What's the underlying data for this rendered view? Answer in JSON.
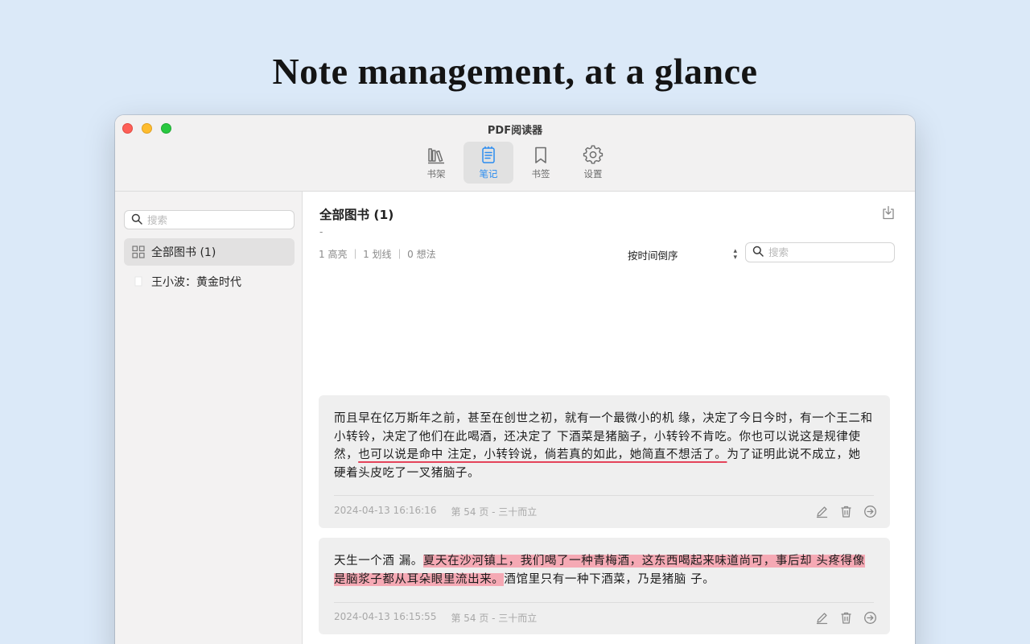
{
  "headline": "Note management, at a glance",
  "window": {
    "title": "PDF阅读器"
  },
  "toolbar": {
    "items": [
      {
        "label": "书架",
        "icon": "bookshelf-icon"
      },
      {
        "label": "笔记",
        "icon": "notes-icon",
        "active": true
      },
      {
        "label": "书签",
        "icon": "bookmark-icon"
      },
      {
        "label": "设置",
        "icon": "gear-icon"
      }
    ]
  },
  "sidebar": {
    "search_placeholder": "搜索",
    "items": [
      {
        "label": "全部图书 (1)",
        "icon": "grid-icon",
        "selected": true
      },
      {
        "label": "王小波：黄金时代",
        "icon": "book-icon"
      }
    ]
  },
  "main": {
    "title": "全部图书 (1)",
    "dash": "-",
    "stats": "1 高亮 ｜ 1 划线 ｜ 0 想法",
    "sort_label": "按时间倒序",
    "search_placeholder": "搜索"
  },
  "notes": [
    {
      "text_plain": "而且早在亿万斯年之前，甚至在创世之初，就有一个最微小的机 缘，决定了今日今时，有一个王二和小转铃，决定了他们在此喝酒，还决定了 下酒菜是猪脑子，小转铃不肯吃。你也可以说这是规律使然，",
      "text_marked": "也可以说是命中 注定，小转铃说，倘若真的如此，她简直不想活了。",
      "text_after": "为了证明此说不成立，她 硬着头皮吃了一叉猪脑子。",
      "timestamp": "2024-04-13 16:16:16",
      "location": "第 54 页 - 三十而立",
      "style": "underline"
    },
    {
      "text_plain": "天生一个酒 漏。",
      "text_marked": "夏天在沙河镇上，我们喝了一种青梅酒，这东西喝起来味道尚可，事后却 头疼得像是脑浆子都从耳朵眼里流出来。",
      "text_after": "酒馆里只有一种下酒菜，乃是猪脑 子。",
      "timestamp": "2024-04-13 16:15:55",
      "location": "第 54 页 - 三十而立",
      "style": "highlight"
    }
  ],
  "colors": {
    "accent": "#2a8cf0",
    "underline": "#e4435a",
    "highlight": "#f5a9b4",
    "background": "#dbe9f8"
  }
}
